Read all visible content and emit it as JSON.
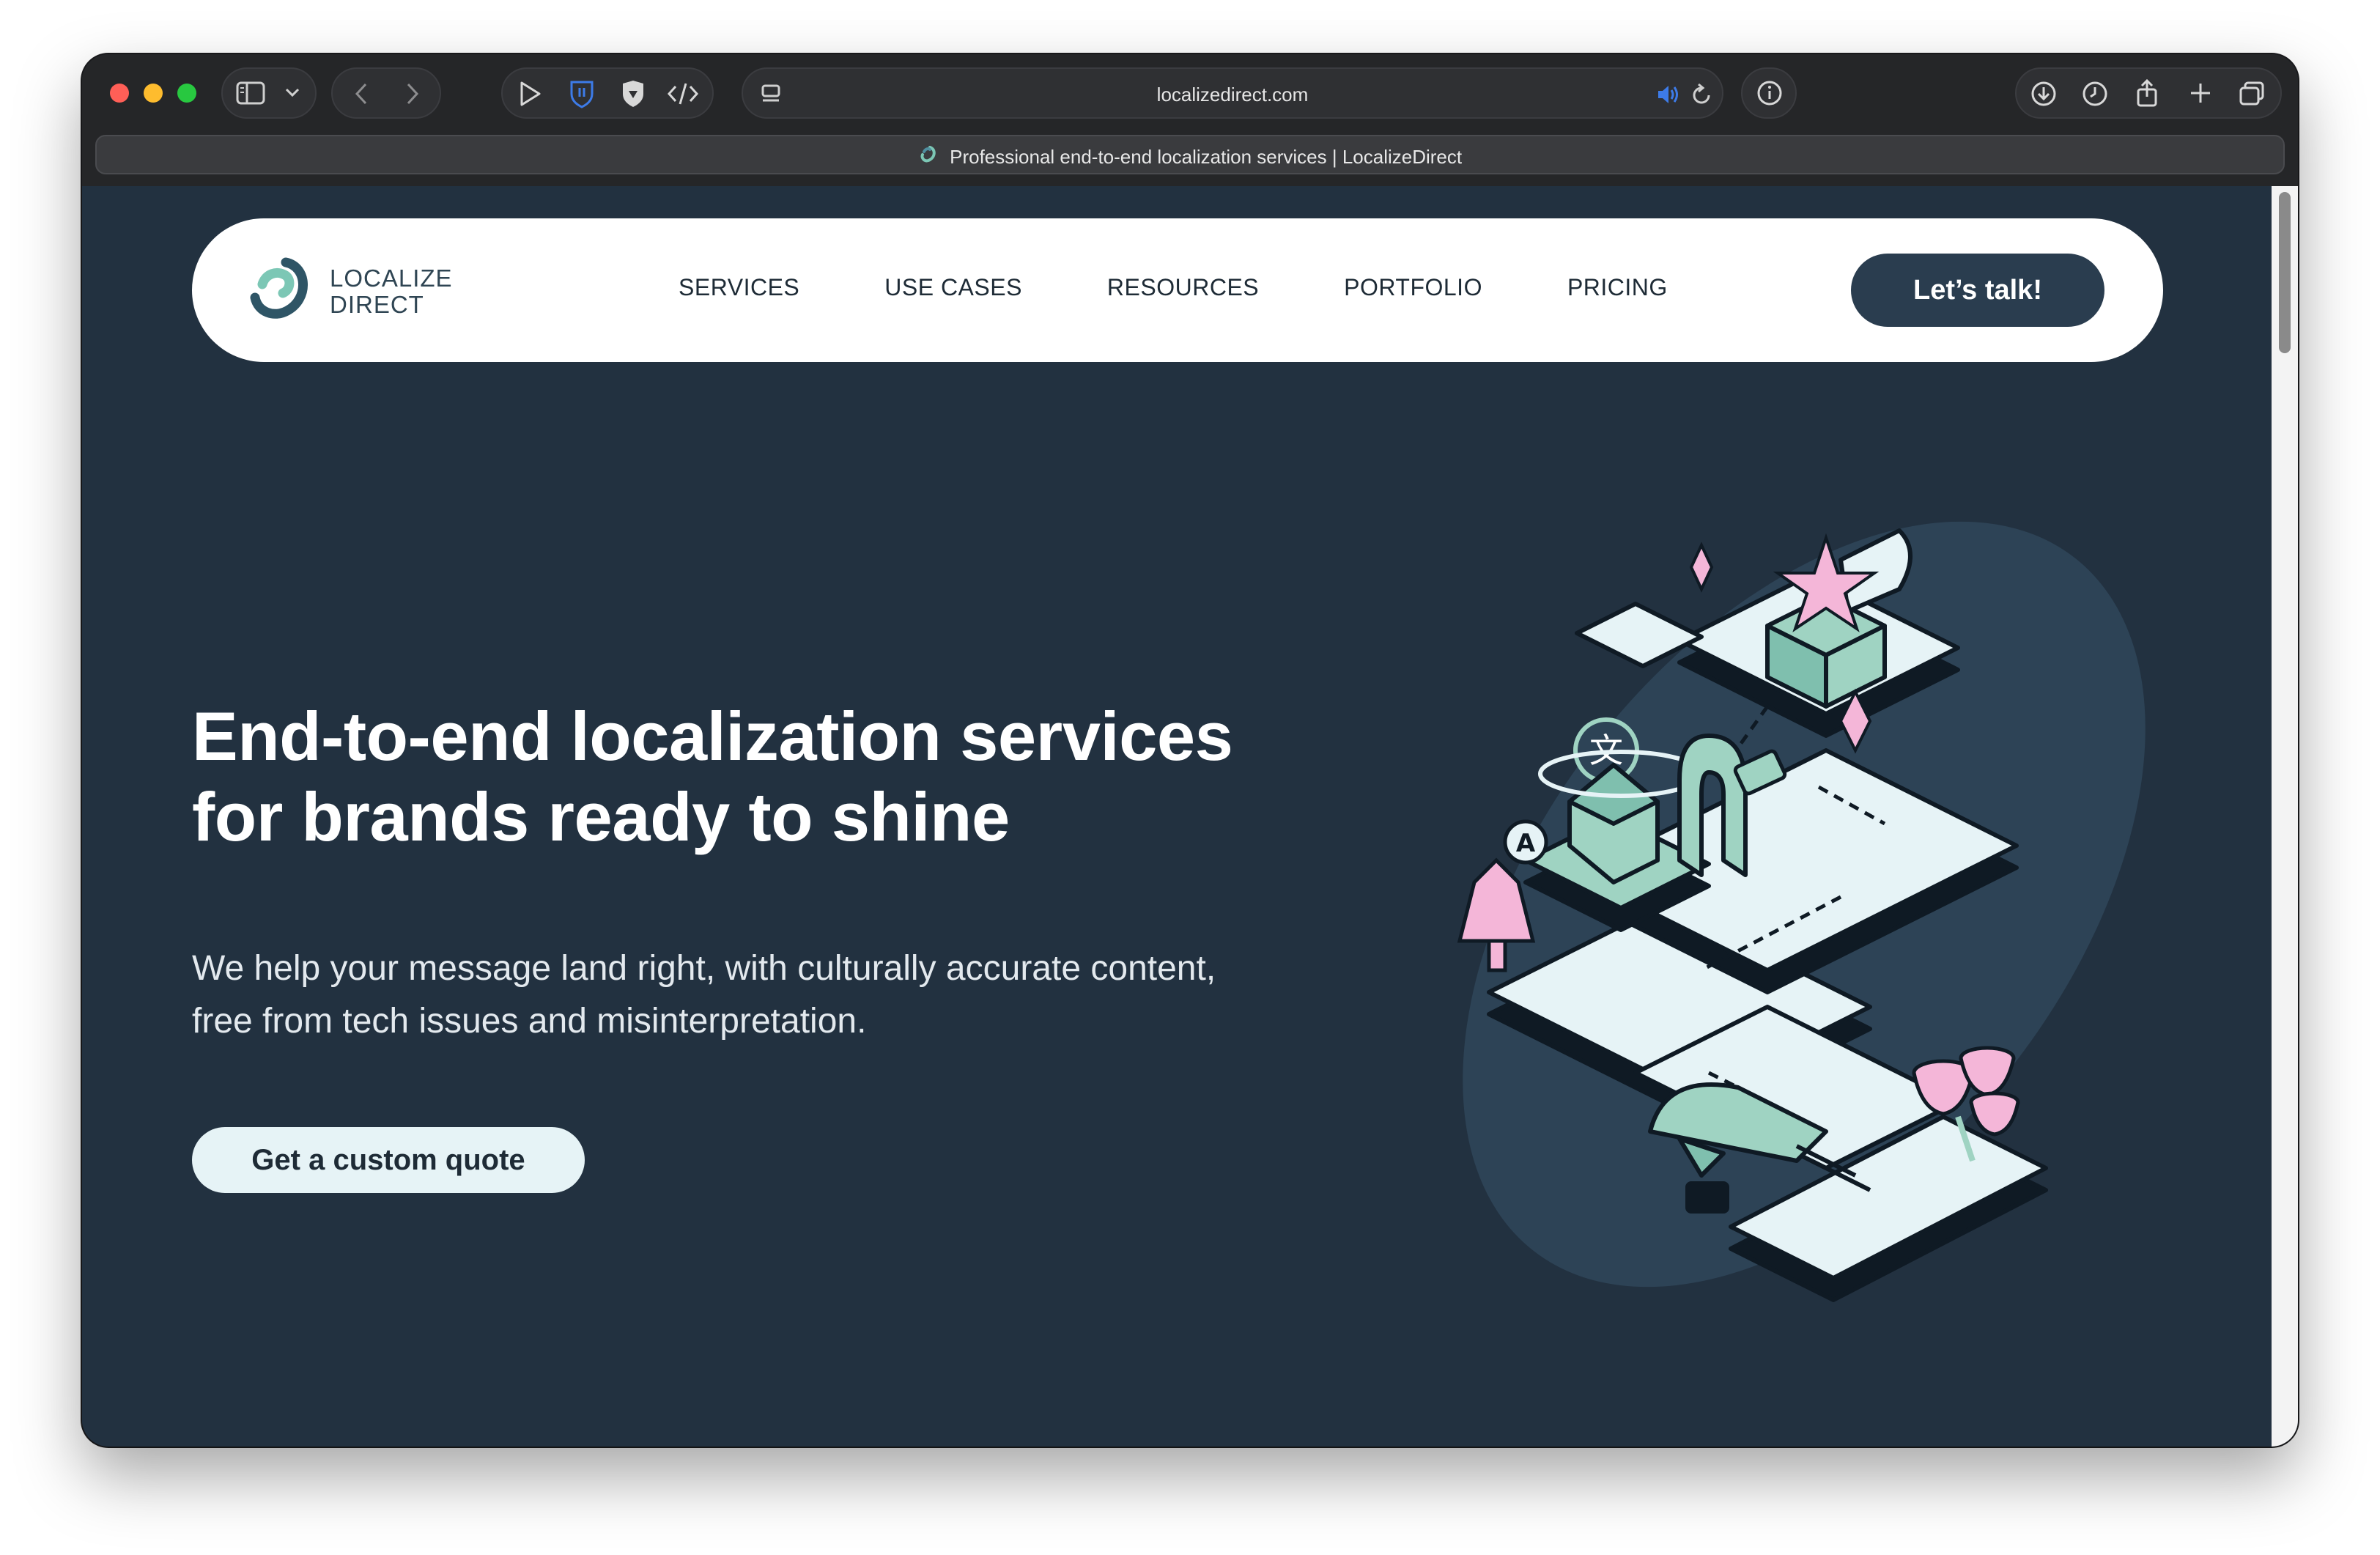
{
  "browser": {
    "url": "localizedirect.com",
    "tab_title": "Professional end-to-end localization services | LocalizeDirect"
  },
  "nav": {
    "logo_line1": "LOCALIZE",
    "logo_line2": "DIRECT",
    "links": [
      "SERVICES",
      "USE CASES",
      "RESOURCES",
      "PORTFOLIO",
      "PRICING"
    ],
    "cta_label": "Let’s talk!"
  },
  "hero": {
    "title_line1": "End-to-end localization services",
    "title_line2": "for brands ready to shine",
    "subtitle_line1": "We help your message land right, with culturally accurate content,",
    "subtitle_line2": "free from tech issues and misinterpretation.",
    "button_label": "Get a custom quote"
  },
  "colors": {
    "page_bg": "#223140",
    "accent_mint": "#9fd3c2",
    "accent_pink": "#f4b6d8",
    "button_dark": "#2a3d4f"
  }
}
